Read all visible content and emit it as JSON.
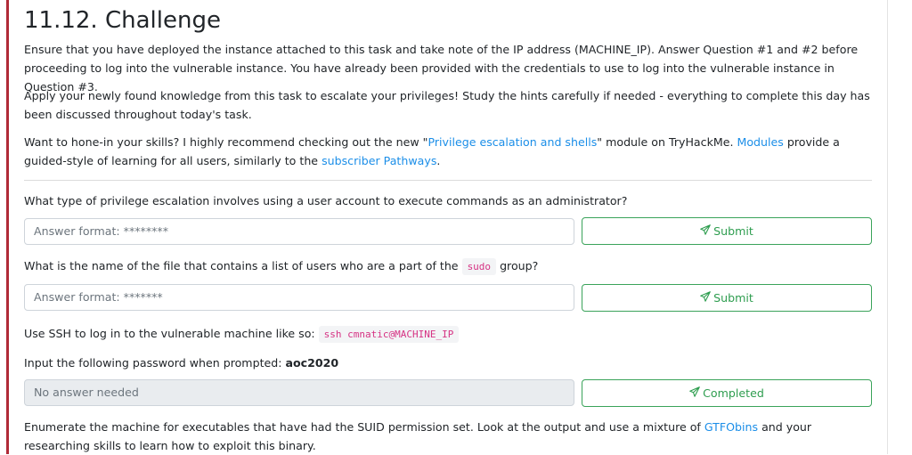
{
  "title": "11.12. Challenge",
  "intro": {
    "p1": "Ensure that you have deployed the instance attached to this task and take note of the IP address (MACHINE_IP). Answer Question #1 and #2 before proceeding to log into the vulnerable instance. You have already been provided with the credentials to use to log into the vulnerable instance in Question #3.",
    "p2": "Apply your newly found knowledge from this task to escalate your privileges! Study the hints carefully if needed - everything to complete this day has been discussed throughout today's task.",
    "p3_before": "Want to hone-in your skills? I highly recommend checking out the new \"",
    "p3_link1": "Privilege escalation and shells",
    "p3_mid1": "\" module on TryHackMe. ",
    "p3_link2": "Modules",
    "p3_mid2": " provide a guided-style of learning for all users, similarly to the ",
    "p3_link3": "subscriber Pathways",
    "p3_end": "."
  },
  "questions": [
    {
      "text": "What type of privilege escalation involves using a user account to execute commands as an administrator?",
      "placeholder": "Answer format: ********",
      "button": "Submit"
    },
    {
      "text_before": "What is the name of the file that contains a list of users who are a part of the ",
      "code": "sudo",
      "text_after": " group?",
      "placeholder": "Answer format: *******",
      "button": "Submit"
    },
    {
      "line1_before": "Use SSH to log in to the vulnerable machine like so: ",
      "line1_code": "ssh cmnatic@MACHINE_IP",
      "line2_before": "Input the following password when prompted: ",
      "line2_bold": "aoc2020",
      "placeholder": "No answer needed",
      "button": "Completed"
    }
  ],
  "q4": {
    "before": "Enumerate the machine for executables that have had the SUID permission set. Look at the output and use a mixture of ",
    "link": "GTFObins",
    "after": " and your researching skills to learn how to exploit this binary."
  },
  "icons": {
    "submit": "paper-plane-icon",
    "completed": "paper-plane-icon"
  },
  "colors": {
    "accent_green": "#2e9d4f",
    "link_blue": "#1b8ee8",
    "code_pink": "#d63384",
    "left_bar": "#b02a37"
  }
}
